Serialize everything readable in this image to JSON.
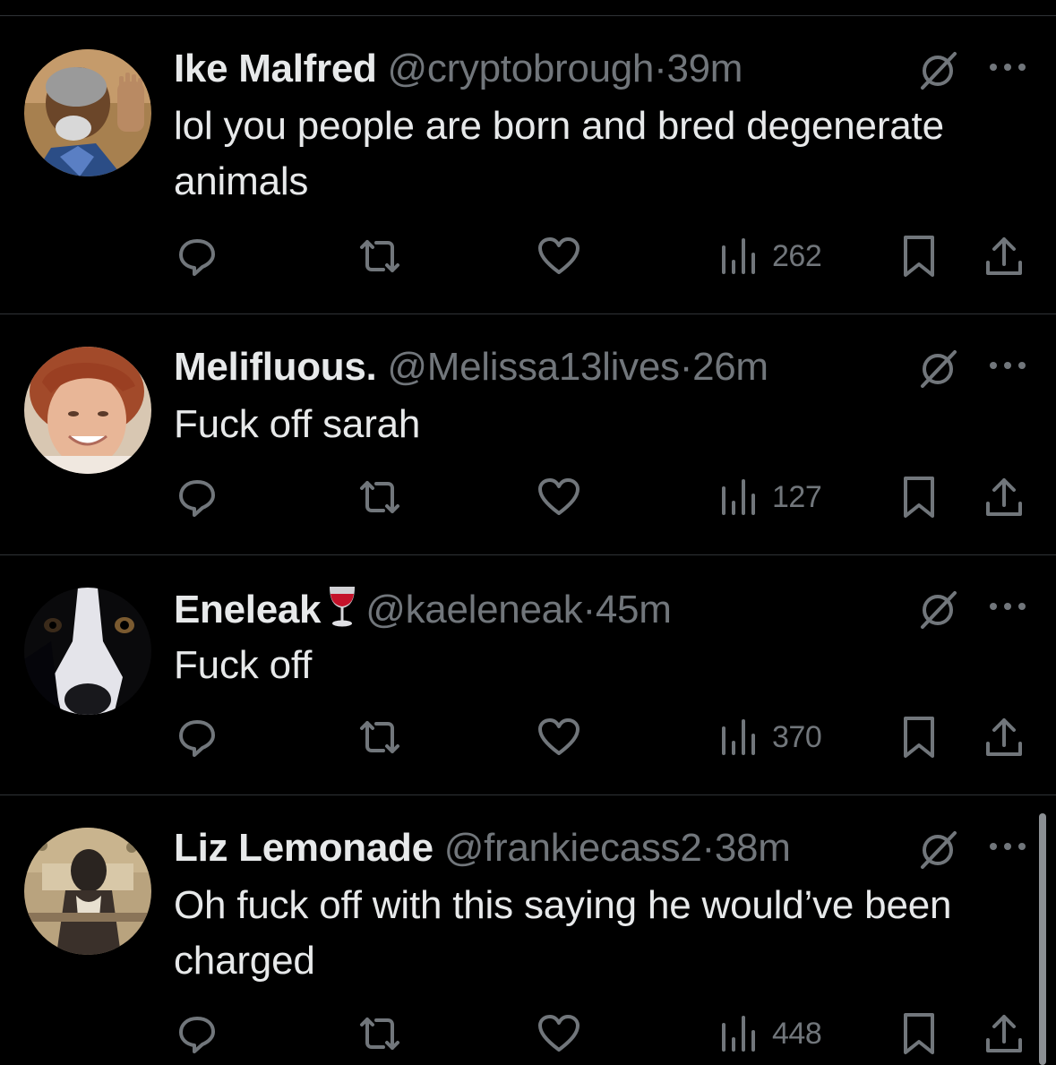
{
  "tweets": [
    {
      "name": "Ike Malfred",
      "emoji": "",
      "handle": "@cryptobrough",
      "sep": "·",
      "time": "39m",
      "text": "lol you people are born and bred degenerate animals",
      "views": "262"
    },
    {
      "name": "Melifluous.",
      "emoji": "",
      "handle": "@Melissa13lives",
      "sep": "·",
      "time": "26m",
      "text": "Fuck off sarah",
      "views": "127"
    },
    {
      "name": "Eneleak",
      "emoji": "🍷",
      "handle": "@kaeleneak",
      "sep": "·",
      "time": "45m",
      "text": "Fuck off",
      "views": "370"
    },
    {
      "name": "Liz Lemonade",
      "emoji": "",
      "handle": "@frankiecass2",
      "sep": "·",
      "time": "38m",
      "text": "Oh fuck off with this saying he would’ve been charged",
      "views": "448"
    }
  ],
  "icons": {
    "reply": "reply-icon",
    "retweet": "retweet-icon",
    "like": "heart-icon",
    "views": "views-icon",
    "bookmark": "bookmark-icon",
    "share": "share-icon",
    "grok": "grok-icon",
    "more": "more-icon"
  },
  "colors": {
    "background": "#000000",
    "text": "#e7e9ea",
    "secondary": "#71767b",
    "divider": "#2f3336"
  }
}
